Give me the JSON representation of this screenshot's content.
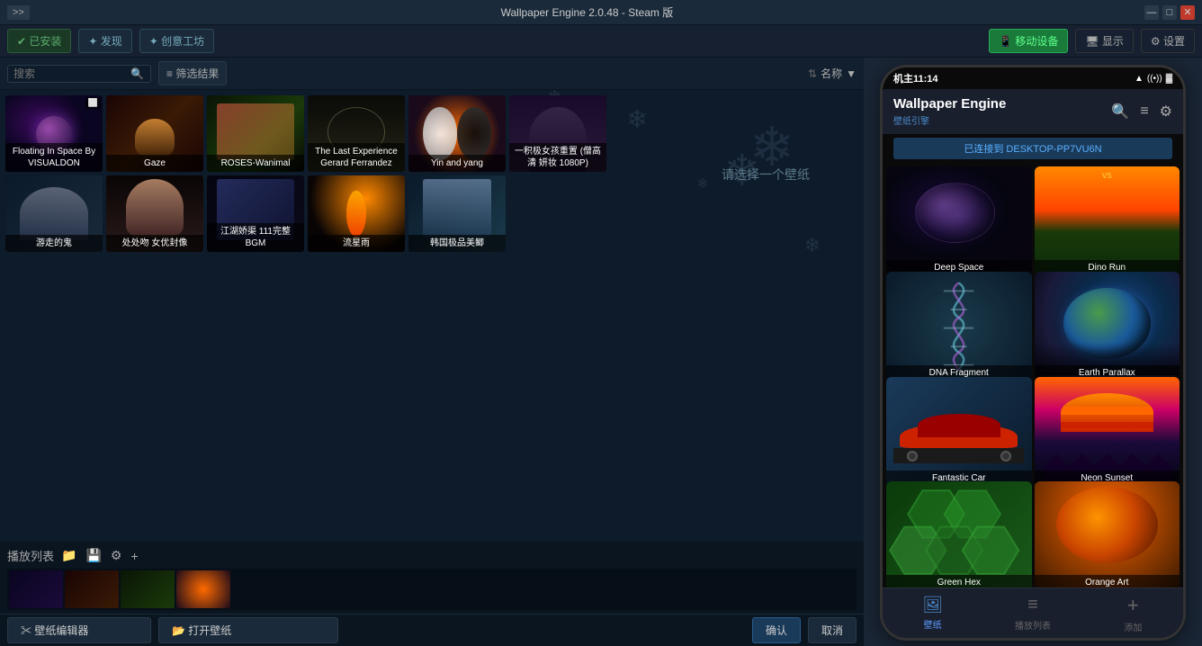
{
  "titleBar": {
    "title": "Wallpaper Engine 2.0.48 - Steam 版",
    "skipLabel": ">>",
    "minimizeLabel": "—",
    "maximizeLabel": "□",
    "closeLabel": "✕"
  },
  "navBar": {
    "installedLabel": "✔ 已安装",
    "discoverLabel": "✦ 发现",
    "workshopLabel": "✦ 创意工坊",
    "mobileLabel": "📱 移动设备",
    "displayLabel": "🖥 显示",
    "settingsLabel": "⚙ 设置"
  },
  "toolbar": {
    "searchPlaceholder": "搜索",
    "filterLabel": "≡ 筛选结果",
    "sortLabel": "名称",
    "sortArrows": "⇅"
  },
  "wallpapers": [
    {
      "id": "w1",
      "title": "Floating In Space By VISUALDON",
      "cssClass": "wp-space",
      "badge": ""
    },
    {
      "id": "w2",
      "title": "Gaze",
      "cssClass": "wp-gaze",
      "badge": ""
    },
    {
      "id": "w3",
      "title": "ROSES-Wanimal",
      "cssClass": "wp-roses",
      "badge": ""
    },
    {
      "id": "w4",
      "title": "The Last Experience Gerard Ferrandez",
      "cssClass": "wp-last",
      "badge": ""
    },
    {
      "id": "w5",
      "title": "Yin and yang",
      "cssClass": "wp-yin",
      "badge": ""
    },
    {
      "id": "w6",
      "title": "一积极女孩重置 (僧高清 妍妆 1080P)",
      "cssClass": "wp-girl",
      "badge": ""
    },
    {
      "id": "w7",
      "title": "游走的鬼",
      "cssClass": "wp-ghost",
      "badge": ""
    },
    {
      "id": "w8",
      "title": "处处吻 女优封像",
      "cssClass": "wp-lady",
      "badge": ""
    },
    {
      "id": "w9",
      "title": "江湖娇渠 111完整BGM",
      "cssClass": "wp-river",
      "badge": ""
    },
    {
      "id": "w10",
      "title": "流星雨",
      "cssClass": "wp-meteor",
      "badge": ""
    },
    {
      "id": "w11",
      "title": "韩国极品美鲫",
      "cssClass": "wp-korean",
      "badge": ""
    }
  ],
  "placeholder": {
    "text": "请选择一个壁纸"
  },
  "playlist": {
    "label": "播放列表",
    "icons": [
      "📁",
      "💾",
      "⚙",
      "+"
    ]
  },
  "actionBar": {
    "editorLabel": "✂ 壁纸编辑器",
    "openWpLabel": "📂 打开壁纸",
    "confirmLabel": "确认",
    "cancelLabel": "取消"
  },
  "phone": {
    "statusBar": {
      "time": "机主11:14",
      "icons": "◀ 📶 🔋"
    },
    "appTitle": "Wallpaper Engine",
    "appSubtitle": "壁纸引擎",
    "connectedLabel": "已连接到 DESKTOP-PP7VU6N",
    "wallpapers": [
      {
        "id": "pw1",
        "title": "Deep Space",
        "cssClass": "phone-wp-deep-space"
      },
      {
        "id": "pw2",
        "title": "Dino Run",
        "cssClass": "phone-wp-dino-run"
      },
      {
        "id": "pw3",
        "title": "DNA Fragment",
        "cssClass": "phone-wp-dna"
      },
      {
        "id": "pw4",
        "title": "Earth Parallax",
        "cssClass": "phone-wp-earth"
      },
      {
        "id": "pw5",
        "title": "Fantastic Car",
        "cssClass": "phone-wp-fantastic-car"
      },
      {
        "id": "pw6",
        "title": "Neon Sunset",
        "cssClass": "phone-wp-neon-sunset"
      },
      {
        "id": "pw7",
        "title": "Green Hex",
        "cssClass": "phone-wp-green-hex"
      },
      {
        "id": "pw8",
        "title": "Orange Art",
        "cssClass": "phone-wp-orange"
      }
    ],
    "bottomNav": [
      {
        "id": "nav-wallpaper",
        "icon": "🖼",
        "label": "壁纸",
        "active": true
      },
      {
        "id": "nav-playlist",
        "icon": "≡",
        "label": "播放列表",
        "active": false
      },
      {
        "id": "nav-add",
        "icon": "+",
        "label": "添加",
        "active": false
      }
    ]
  },
  "colors": {
    "accent": "#4a8ac8",
    "green": "#5daa6e",
    "bg": "#0d1b2a",
    "panel": "#162030"
  }
}
